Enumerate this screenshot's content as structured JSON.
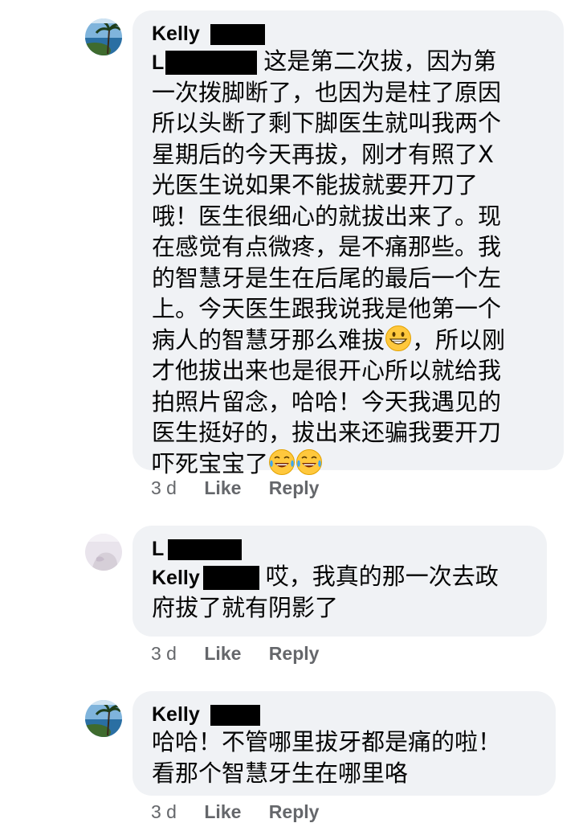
{
  "comments": [
    {
      "author": "Kelly",
      "avatar_icon": "beach-photo-avatar",
      "mention": "L",
      "lines": [
        "这是第二次拔，因为第",
        "一次拨脚断了，也因为是柱了原因",
        "所以头断了剩下脚医生就叫我两个",
        "星期后的今天再拔，刚才有照了X",
        "光医生说如果不能拔就要开刀了",
        "哦！医生很细心的就拔出来了。现",
        "在感觉有点微疼，是不痛那些。我",
        "的智慧牙是生在后尾的最后一个左",
        "上。今天医生跟我说我是他第一个",
        "病人的智慧牙那么难拔",
        "，所以刚",
        "才他拔出来也是很开心所以就给我",
        "拍照片留念，哈哈！今天我遇见的",
        "医生挺好的，拔出来还骗我要开刀",
        "吓死宝宝了"
      ],
      "time": "3 d",
      "like": "Like",
      "reply": "Reply"
    },
    {
      "author": "L",
      "avatar_icon": "pale-photo-avatar",
      "mention": "Kelly",
      "lines": [
        "哎，我真的那一次去政",
        "府拔了就有阴影了"
      ],
      "time": "3 d",
      "like": "Like",
      "reply": "Reply"
    },
    {
      "author": "Kelly",
      "avatar_icon": "beach-photo-avatar",
      "lines": [
        "哈哈！不管哪里拔牙都是痛的啦！",
        "看那个智慧牙生在哪里咯"
      ],
      "time": "3 d",
      "like": "Like",
      "reply": "Reply"
    }
  ],
  "emojis": [
    "grinning-face-emoji",
    "tears-of-joy-emoji"
  ],
  "colors": {
    "bubble": "#f0f2f5",
    "meta_text": "#65676b",
    "text": "#050505",
    "redaction": "#000000"
  }
}
